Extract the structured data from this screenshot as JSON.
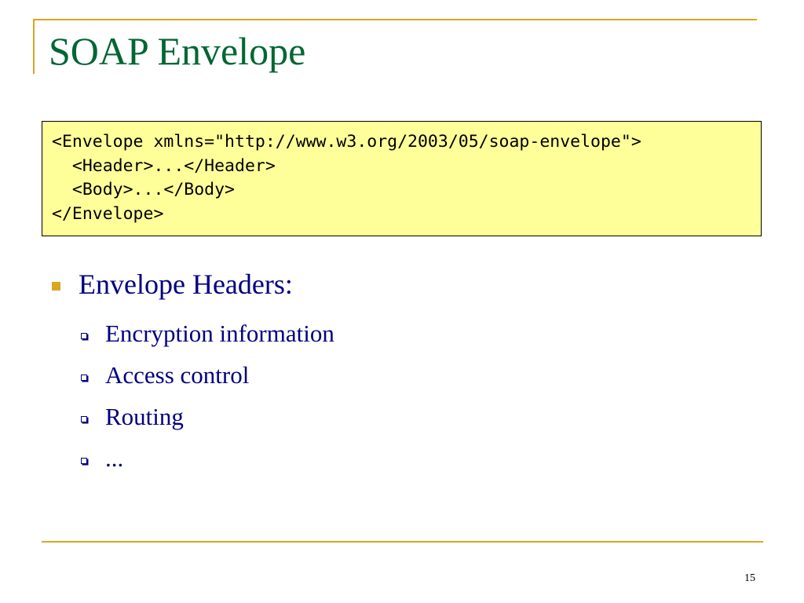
{
  "slide": {
    "title": "SOAP Envelope",
    "code_lines": [
      "<Envelope xmlns=\"http://www.w3.org/2003/05/soap-envelope\">",
      "  <Header>...</Header>",
      "  <Body>...</Body>",
      "</Envelope>"
    ],
    "bullet": {
      "label": "Envelope Headers:",
      "sub_items": [
        "Encryption information",
        "Access control",
        "Routing",
        "..."
      ]
    },
    "page_number": "15"
  },
  "colors": {
    "accent": "#DAA520",
    "title": "#006633",
    "body_text": "#000080",
    "code_background": "#FFFF99"
  }
}
